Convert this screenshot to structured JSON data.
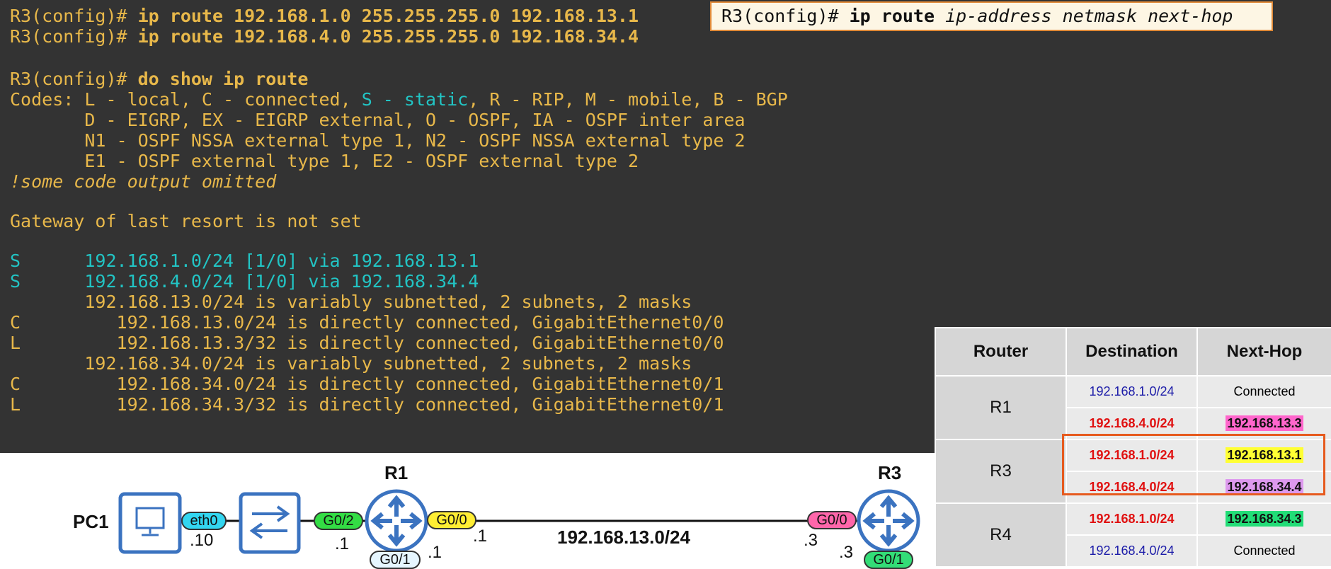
{
  "terminal": {
    "lines": [
      {
        "prefix": "R3(config)# ",
        "cmd": "ip route 192.168.1.0 255.255.255.0 192.168.13.1"
      },
      {
        "prefix": "R3(config)# ",
        "cmd": "ip route 192.168.4.0 255.255.255.0 192.168.34.4"
      },
      {
        "prefix": "R3(config)# ",
        "cmd": "do show ip route"
      }
    ],
    "codes": {
      "l1a": "Codes: L - local, C - connected, ",
      "l1b": "S - static",
      "l1c": ", R - RIP, M - mobile, B - BGP",
      "l2": "       D - EIGRP, EX - EIGRP external, O - OSPF, IA - OSPF inter area",
      "l3": "       N1 - OSPF NSSA external type 1, N2 - OSPF NSSA external type 2",
      "l4": "       E1 - OSPF external type 1, E2 - OSPF external type 2"
    },
    "omitted": "!some code output omitted",
    "gateway": "Gateway of last resort is not set",
    "routes": [
      {
        "text": "S      192.168.1.0/24 [1/0] via 192.168.13.1",
        "color": "cyan"
      },
      {
        "text": "S      192.168.4.0/24 [1/0] via 192.168.34.4",
        "color": "cyan"
      },
      {
        "text": "       192.168.13.0/24 is variably subnetted, 2 subnets, 2 masks",
        "color": "yellow"
      },
      {
        "text": "C         192.168.13.0/24 is directly connected, GigabitEthernet0/0",
        "color": "yellow"
      },
      {
        "text": "L         192.168.13.3/32 is directly connected, GigabitEthernet0/0",
        "color": "yellow"
      },
      {
        "text": "       192.168.34.0/24 is variably subnetted, 2 subnets, 2 masks",
        "color": "yellow"
      },
      {
        "text": "C         192.168.34.0/24 is directly connected, GigabitEthernet0/1",
        "color": "yellow"
      },
      {
        "text": "L         192.168.34.3/32 is directly connected, GigabitEthernet0/1",
        "color": "yellow"
      }
    ]
  },
  "syntax": {
    "prefix": "R3(config)# ",
    "cmd": "ip route ",
    "args": "ip-address netmask next-hop"
  },
  "table": {
    "headers": [
      "Router",
      "Destination",
      "Next-Hop"
    ],
    "r1": "R1",
    "r3": "R3",
    "r4": "R4",
    "rows": [
      {
        "dest": "192.168.1.0/24",
        "hop": "Connected"
      },
      {
        "dest": "192.168.4.0/24",
        "hop": "192.168.13.3"
      },
      {
        "dest": "192.168.1.0/24",
        "hop": "192.168.13.1"
      },
      {
        "dest": "192.168.4.0/24",
        "hop": "192.168.34.4"
      },
      {
        "dest": "192.168.1.0/24",
        "hop": "192.168.34.3"
      },
      {
        "dest": "192.168.4.0/24",
        "hop": "Connected"
      }
    ],
    "hop_highlights": [
      "#ff66cc",
      "#ffff33",
      "#dd99ee",
      "#22dd77"
    ]
  },
  "diagram": {
    "pc_label": "PC1",
    "pc_iface": "eth0",
    "pc_addr": ".10",
    "r1_label": "R1",
    "r1_g02": "G0/2",
    "r1_g02_addr": ".1",
    "r1_g00": "G0/0",
    "r1_g00_addr": ".1",
    "r1_g01": "G0/1",
    "r1_g01_addr": ".1",
    "subnet": "192.168.13.0/24",
    "r3_label": "R3",
    "r3_g00": "G0/0",
    "r3_g00_addr": ".3",
    "r3_g01": "G0/1",
    "r3_g01_addr": ".3",
    "colors": {
      "eth0": "#33d6f0",
      "g02": "#33dd44",
      "g00": "#ffee33",
      "r3g00": "#ff66aa",
      "g01": "#e6f6ff",
      "r3g01": "#33dd77",
      "device": "#3b73c0"
    }
  }
}
